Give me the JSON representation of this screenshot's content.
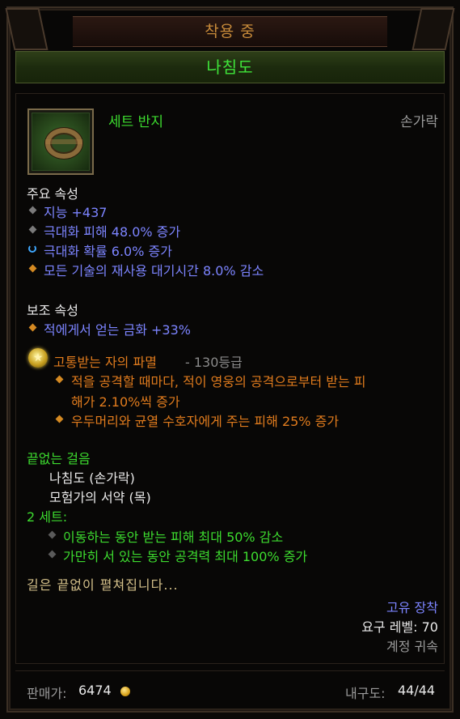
{
  "header": {
    "equipped_label": "착용 중"
  },
  "item": {
    "name": "나침도",
    "type": "세트 반지",
    "slot": "손가락",
    "icon": "ring-icon"
  },
  "primary": {
    "heading": "주요 속성",
    "stats": [
      {
        "text": "지능 +437",
        "bullet": "grey-diamond"
      },
      {
        "text": "극대화 피해 48.0% 증가",
        "bullet": "grey-diamond"
      },
      {
        "text": "극대화 확률 6.0% 증가",
        "bullet": "reroll-icon"
      },
      {
        "text": "모든 기술의 재사용 대기시간 8.0% 감소",
        "bullet": "orange-diamond"
      }
    ]
  },
  "secondary": {
    "heading": "보조 속성",
    "stats": [
      {
        "text": "적에게서 얻는 금화 +33%",
        "bullet": "orange-diamond"
      }
    ]
  },
  "legendary_gem": {
    "icon": "gem-icon",
    "name": "고통받는 자의 파멸",
    "rank": "- 130등급",
    "effects": [
      {
        "line1": "적을 공격할 때마다, 적이 영웅의 공격으로부터 받는 피",
        "line2": "해가 2.10%씩 증가"
      },
      {
        "line1": "우두머리와 균열 수호자에게 주는 피해 25% 증가"
      }
    ]
  },
  "set": {
    "name": "끝없는 걸음",
    "pieces": [
      "나침도 (손가락)",
      "모험가의 서약 (목)"
    ],
    "bonus_heading": "2 세트:",
    "bonuses": [
      "이동하는 동안 받는 피해 최대 50% 감소",
      "가만히 서 있는 동안 공격력 최대 100% 증가"
    ]
  },
  "flavor": "길은 끝없이 펼쳐집니다...",
  "requirements": {
    "unique_equip": "고유 장착",
    "level": "요구 레벨: 70",
    "bound": "계정 귀속"
  },
  "footer": {
    "sell_label": "판매가:",
    "sell_value": "6474",
    "durability_label": "내구도:",
    "durability_value": "44/44"
  },
  "colors": {
    "set_green": "#3ddc2f",
    "magic_blue": "#7c84ff",
    "legendary_orange": "#e07b1d",
    "equipped_gold": "#c88b3a"
  }
}
